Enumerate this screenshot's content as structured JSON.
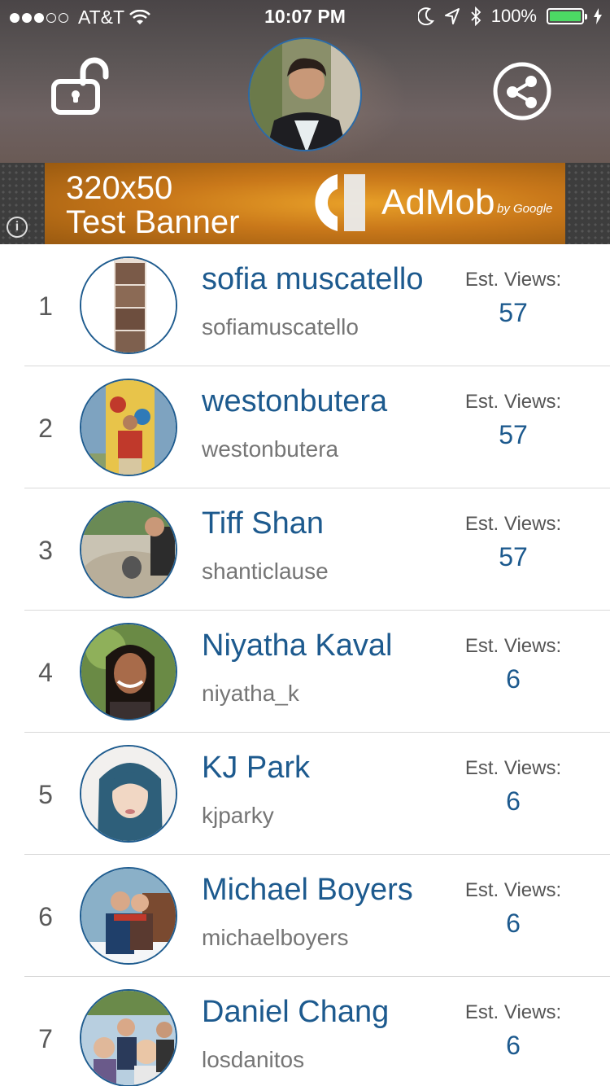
{
  "status_bar": {
    "carrier": "AT&T",
    "time": "10:07 PM",
    "battery_percent": "100%",
    "signal_bars_filled": 3,
    "signal_bars_total": 5
  },
  "header": {
    "lock_icon": "unlock-icon",
    "share_icon": "share-icon"
  },
  "ad": {
    "line1": "320x50",
    "line2": "Test Banner",
    "brand": "AdMob",
    "by_google": "by Google",
    "info_icon": "info-icon"
  },
  "list": {
    "views_label": "Est. Views:",
    "items": [
      {
        "rank": "1",
        "name": "sofia muscatello",
        "handle": "sofiamuscatello",
        "views": "57"
      },
      {
        "rank": "2",
        "name": "westonbutera",
        "handle": "westonbutera",
        "views": "57"
      },
      {
        "rank": "3",
        "name": "Tiff Shan",
        "handle": "shanticlause",
        "views": "57"
      },
      {
        "rank": "4",
        "name": "Niyatha Kaval",
        "handle": "niyatha_k",
        "views": "6"
      },
      {
        "rank": "5",
        "name": "KJ Park",
        "handle": "kjparky",
        "views": "6"
      },
      {
        "rank": "6",
        "name": "Michael Boyers",
        "handle": "michaelboyers",
        "views": "6"
      },
      {
        "rank": "7",
        "name": "Daniel Chang",
        "handle": "losdanitos",
        "views": "6"
      }
    ]
  },
  "colors": {
    "accent": "#1d5a8e",
    "battery_green": "#4cd964"
  }
}
